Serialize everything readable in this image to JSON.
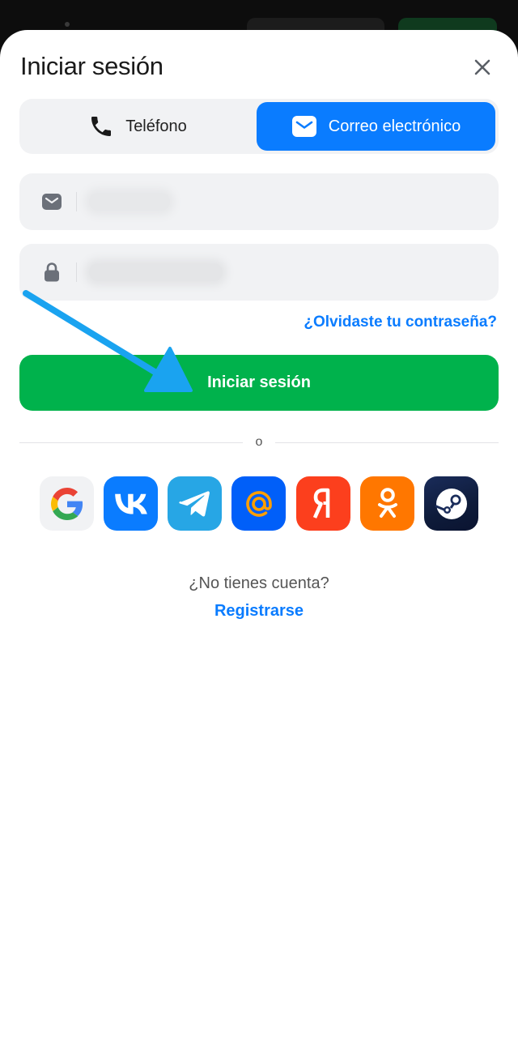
{
  "dialog": {
    "title": "Iniciar sesión"
  },
  "tabs": [
    {
      "label": "Teléfono",
      "active": false
    },
    {
      "label": "Correo electrónico",
      "active": true
    }
  ],
  "form": {
    "email": {
      "value": "",
      "icon": "envelope-icon"
    },
    "password": {
      "value": "",
      "icon": "lock-icon"
    },
    "forgot_label": "¿Olvidaste tu contraseña?",
    "submit_label": "Iniciar sesión"
  },
  "divider_label": "o",
  "social": [
    "Google",
    "VK",
    "Telegram",
    "Mail.ru",
    "Yandex",
    "Odnoklassniki",
    "Steam"
  ],
  "signup": {
    "prompt": "¿No tienes cuenta?",
    "link": "Registrarse"
  },
  "colors": {
    "accent": "#0a7cff",
    "primary_button": "#00b24c",
    "field_bg": "#f1f2f4",
    "annotation_arrow": "#1aa3f0"
  }
}
